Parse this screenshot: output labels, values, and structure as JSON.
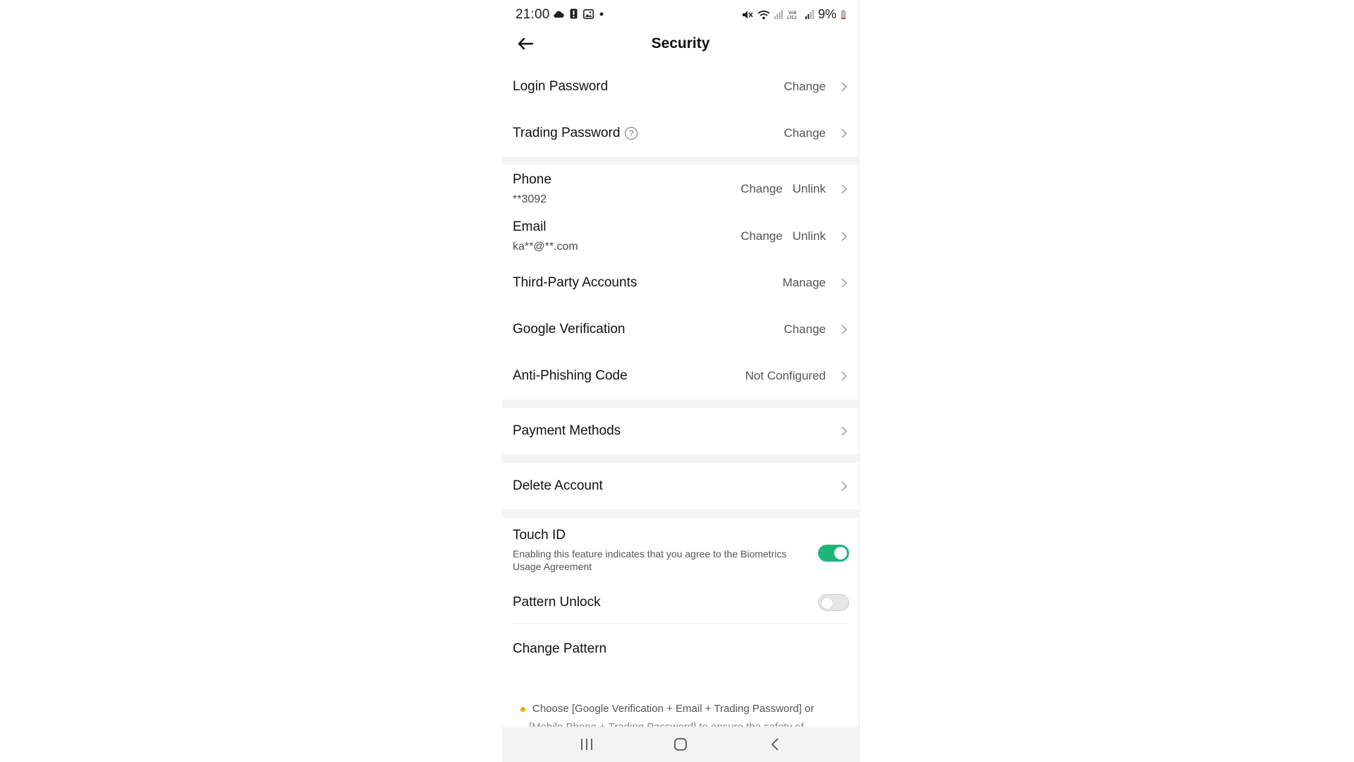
{
  "status_bar": {
    "time": "21:00",
    "battery": "9%",
    "left_icons": [
      "cloud-icon",
      "alert-icon",
      "gallery-icon",
      "dot-icon"
    ],
    "right_icons": [
      "mute-icon",
      "wifi-icon",
      "signal-icon",
      "volte-icon",
      "signal-icon",
      "battery-icon"
    ]
  },
  "header": {
    "title": "Security",
    "back_icon": "arrow-left-icon"
  },
  "rows": {
    "login_password": {
      "title": "Login Password",
      "action": "Change"
    },
    "trading_password": {
      "title": "Trading Password",
      "help": "?",
      "action": "Change"
    },
    "phone": {
      "title": "Phone",
      "value": "**3092",
      "action1": "Change",
      "action2": "Unlink"
    },
    "email": {
      "title": "Email",
      "value": "ka**@**.com",
      "action1": "Change",
      "action2": "Unlink"
    },
    "third_party": {
      "title": "Third-Party Accounts",
      "action": "Manage"
    },
    "google": {
      "title": "Google Verification",
      "action": "Change"
    },
    "anti_phishing": {
      "title": "Anti-Phishing Code",
      "action": "Not Configured"
    },
    "payment": {
      "title": "Payment Methods"
    },
    "delete": {
      "title": "Delete Account"
    }
  },
  "touch_id": {
    "title": "Touch ID",
    "hint": "Enabling this feature indicates that you agree to the Biometrics Usage Agreement",
    "enabled": true
  },
  "pattern_unlock": {
    "title": "Pattern Unlock",
    "enabled": false
  },
  "change_pattern": {
    "title": "Change Pattern"
  },
  "note": {
    "text": "Choose [Google Verification + Email + Trading Password] or",
    "cut": "[Mobile Phone + Trading Password] to ensure the safety of"
  },
  "colors": {
    "accent": "#1db77a",
    "bullet": "#f0a800",
    "separator": "#f4f4f4"
  },
  "nav": {
    "recents_icon": "recents-icon",
    "home_icon": "home-icon",
    "back_icon": "back-chevron-icon"
  }
}
